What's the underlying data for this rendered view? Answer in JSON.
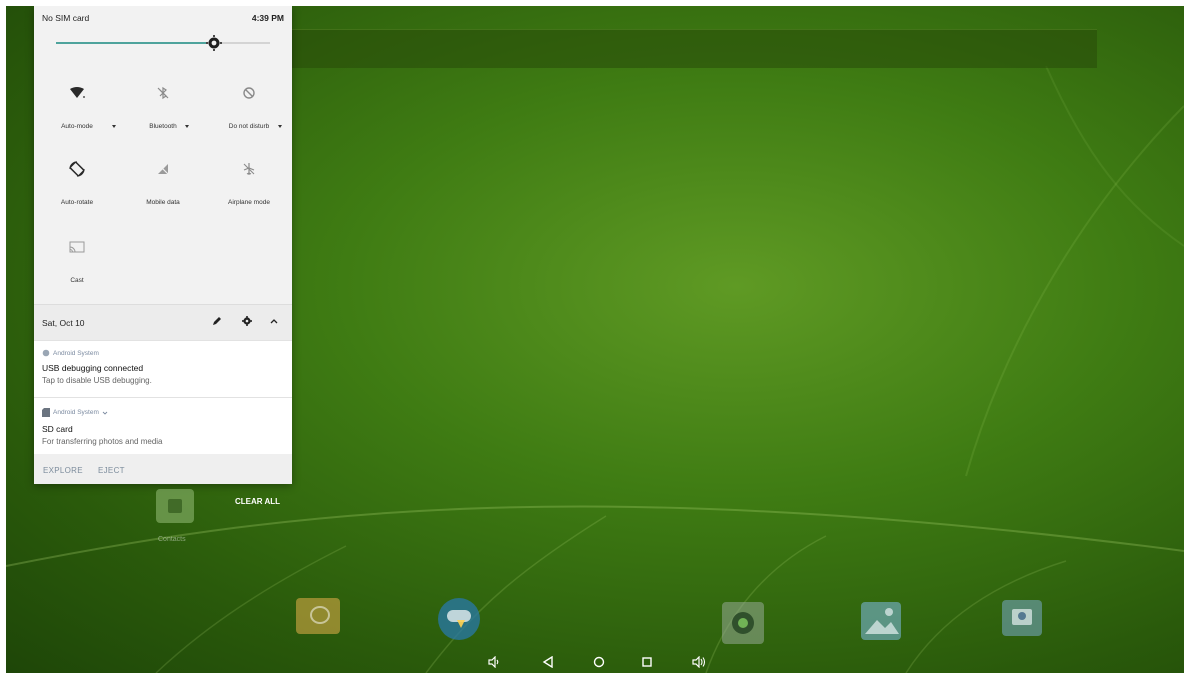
{
  "status_bar": {
    "carrier": "No SIM card",
    "time": "4:39 PM"
  },
  "brightness": {
    "level": 0.74
  },
  "quick_settings": {
    "tiles": [
      {
        "label": "Auto-mode",
        "icon": "wifi-icon"
      },
      {
        "label": "Bluetooth",
        "icon": "bluetooth-off-icon"
      },
      {
        "label": "Do not disturb",
        "icon": "do-not-disturb-icon"
      },
      {
        "label": "Auto-rotate",
        "icon": "auto-rotate-icon"
      },
      {
        "label": "Mobile data",
        "icon": "mobile-data-off-icon"
      },
      {
        "label": "Airplane mode",
        "icon": "airplane-off-icon"
      },
      {
        "label": "Cast",
        "icon": "cast-icon"
      }
    ]
  },
  "date_bar": {
    "date": "Sat, Oct 10"
  },
  "notifications": [
    {
      "app": "Android System",
      "title": "USB debugging connected",
      "body": "Tap to disable USB debugging."
    },
    {
      "app": "Android System",
      "title": "SD card",
      "body": "For transferring photos and media"
    }
  ],
  "notification_actions": {
    "explore": "EXPLORE",
    "eject": "EJECT"
  },
  "recents": {
    "clear_all": "CLEAR ALL"
  },
  "desktop": {
    "contacts_label": "Contacts"
  },
  "colors": {
    "accent_teal": "#1f8f86",
    "wallpaper_green": "#3f7c13"
  }
}
